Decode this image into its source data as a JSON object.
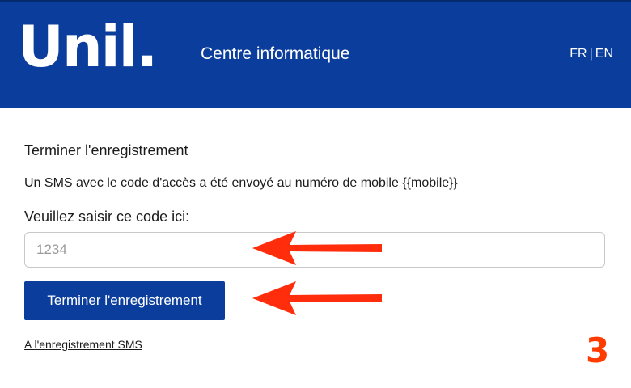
{
  "header": {
    "logo_text": "Unil.",
    "site_title": "Centre informatique",
    "lang_fr": "FR",
    "lang_separator": "|",
    "lang_en": "EN",
    "background_color": "#0a3d9c"
  },
  "form": {
    "heading": "Terminer l'enregistrement",
    "message": "Un SMS avec le code d'accès a été envoyé au numéro de mobile {{mobile}}",
    "field_label": "Veuillez saisir ce code ici:",
    "code_input": {
      "value": "",
      "placeholder": "1234"
    },
    "submit_label": "Terminer l'enregistrement",
    "back_link_label": "A l'enregistrement SMS"
  },
  "annotations": {
    "arrow_color": "#ff2d0b",
    "arrow_icon": "arrow-left-icon",
    "step_number": "3",
    "step_color": "#ff3b00"
  }
}
